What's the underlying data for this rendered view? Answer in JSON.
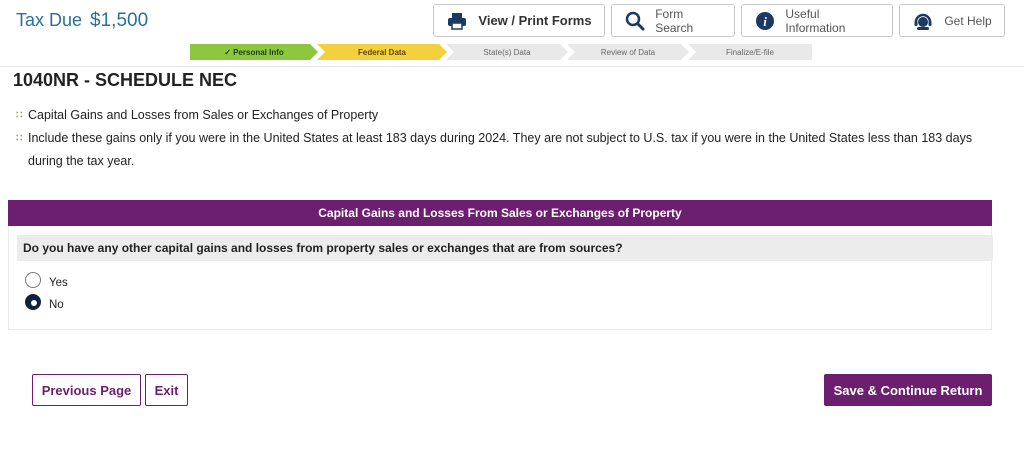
{
  "header": {
    "tax_due_label": "Tax Due",
    "tax_due_amount": "$1,500"
  },
  "toolbar": {
    "view_print": "View / Print Forms",
    "form_search": "Form Search",
    "useful_info": "Useful Information",
    "get_help": "Get Help"
  },
  "progress": {
    "steps": [
      {
        "label": "✓ Personal Info",
        "status": "complete",
        "color": "#8dc63f"
      },
      {
        "label": "Federal Data",
        "status": "current",
        "color": "#f4d03f"
      },
      {
        "label": "State(s) Data",
        "status": "pending",
        "color": "#e9e9e9"
      },
      {
        "label": "Review of Data",
        "status": "pending",
        "color": "#e9e9e9"
      },
      {
        "label": "Finalize/E-file",
        "status": "pending",
        "color": "#e9e9e9"
      }
    ]
  },
  "page": {
    "title": "1040NR - SCHEDULE NEC",
    "bullets": [
      "Capital Gains and Losses from Sales or Exchanges of Property",
      "Include these gains only if you were in the United States at least 183 days during 2024. They are not subject to U.S. tax if you were in the United States less than 183 days during the tax year."
    ]
  },
  "section": {
    "title": "Capital Gains and Losses From Sales or Exchanges of Property",
    "question": "Do you have any other capital gains and losses from property sales or exchanges that are from sources?",
    "options": [
      {
        "label": "Yes",
        "selected": false
      },
      {
        "label": "No",
        "selected": true
      }
    ]
  },
  "footer": {
    "previous": "Previous Page",
    "exit": "Exit",
    "save_continue": "Save & Continue Return"
  },
  "colors": {
    "brand_purple": "#6b1f6e",
    "tax_due_blue": "#2b6f9e",
    "bullet_green": "#6ab04c"
  },
  "icons": {
    "view_print": "printer-icon",
    "form_search": "search-icon",
    "useful_info": "info-icon",
    "get_help": "support-agent-icon",
    "bullet": "bullet-dots-icon"
  }
}
